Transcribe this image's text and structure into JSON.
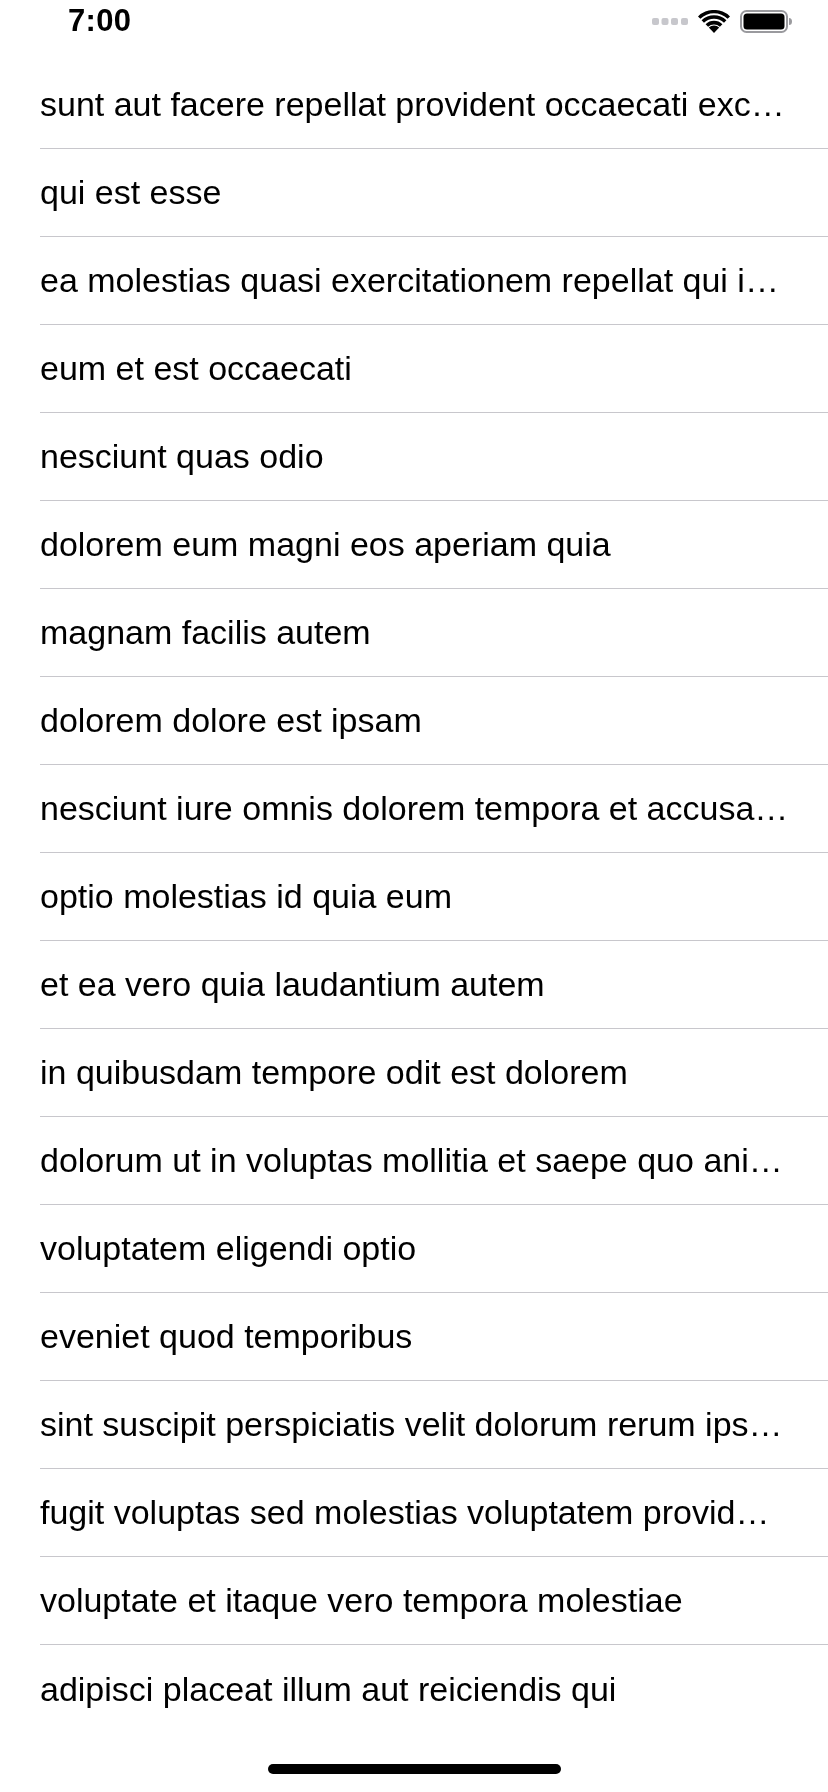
{
  "status_bar": {
    "time": "7:00"
  },
  "rows": [
    "sunt aut facere repellat provident occaecati exc…",
    "qui est esse",
    "ea molestias quasi exercitationem repellat qui i…",
    "eum et est occaecati",
    "nesciunt quas odio",
    "dolorem eum magni eos aperiam quia",
    "magnam facilis autem",
    "dolorem dolore est ipsam",
    "nesciunt iure omnis dolorem tempora et accusa…",
    "optio molestias id quia eum",
    "et ea vero quia laudantium autem",
    "in quibusdam tempore odit est dolorem",
    "dolorum ut in voluptas mollitia et saepe quo ani…",
    "voluptatem eligendi optio",
    "eveniet quod temporibus",
    "sint suscipit perspiciatis velit dolorum rerum ips…",
    "fugit voluptas sed molestias voluptatem provid…",
    "voluptate et itaque vero tempora molestiae",
    "adipisci placeat illum aut reiciendis qui"
  ]
}
